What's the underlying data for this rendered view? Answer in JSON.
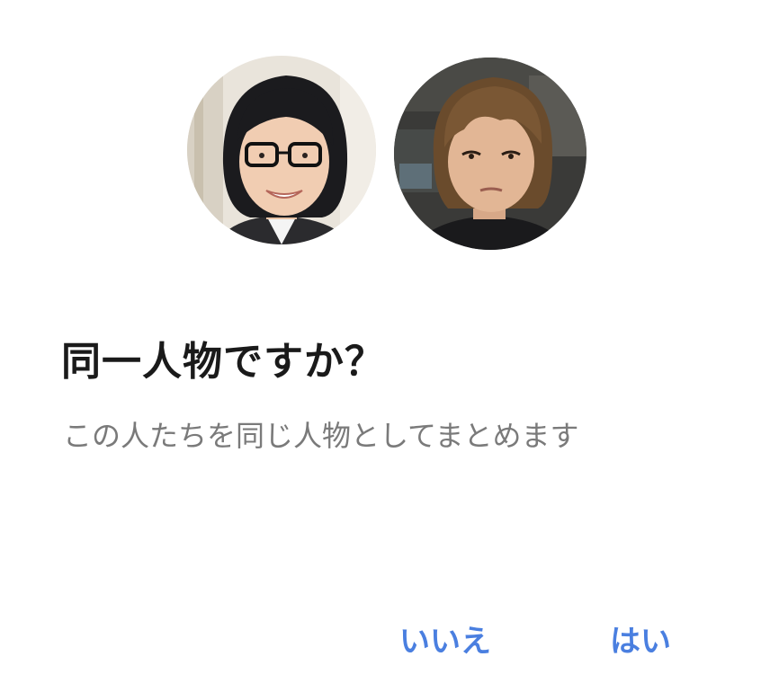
{
  "dialog": {
    "title": "同一人物ですか？",
    "description": "この人たちを同じ人物としてまとめます",
    "buttons": {
      "no_label": "いいえ",
      "yes_label": "はい"
    },
    "avatars": [
      {
        "name": "face-photo-1"
      },
      {
        "name": "face-photo-2"
      }
    ],
    "colors": {
      "accent": "#4a7fe0",
      "title": "#1a1a1a",
      "description": "#7a7a7a",
      "background": "#ffffff"
    }
  }
}
